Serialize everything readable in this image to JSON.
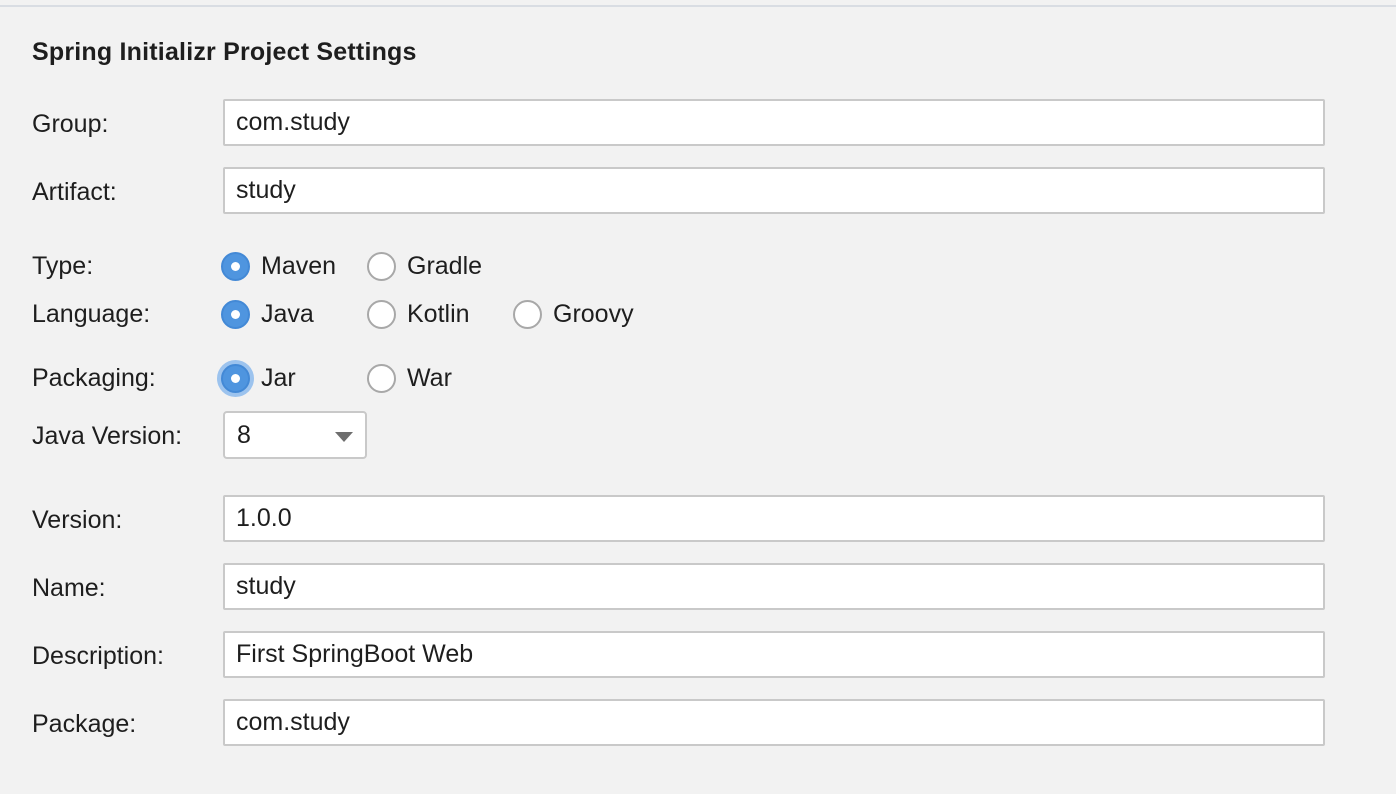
{
  "dialog": {
    "title": "Spring Initializr Project Settings"
  },
  "fields": {
    "group": {
      "label": "Group:",
      "value": "com.study"
    },
    "artifact": {
      "label": "Artifact:",
      "value": "study"
    },
    "version": {
      "label": "Version:",
      "value": "1.0.0"
    },
    "name": {
      "label": "Name:",
      "value": "study"
    },
    "description": {
      "label": "Description:",
      "value": "First SpringBoot Web"
    },
    "package": {
      "label": "Package:",
      "value": "com.study"
    }
  },
  "type": {
    "label": "Type:",
    "options": [
      "Maven",
      "Gradle"
    ],
    "selected": "Maven"
  },
  "language": {
    "label": "Language:",
    "options": [
      "Java",
      "Kotlin",
      "Groovy"
    ],
    "selected": "Java"
  },
  "packaging": {
    "label": "Packaging:",
    "options": [
      "Jar",
      "War"
    ],
    "selected": "Jar"
  },
  "java_version": {
    "label": "Java Version:",
    "selected": "8"
  },
  "colors": {
    "accent": "#4f95df",
    "focus_ring": "#9cc3ee",
    "background": "#f2f2f2",
    "field_border": "#c9c9c9"
  },
  "icons": {
    "dropdown": "chevron-down-icon"
  }
}
